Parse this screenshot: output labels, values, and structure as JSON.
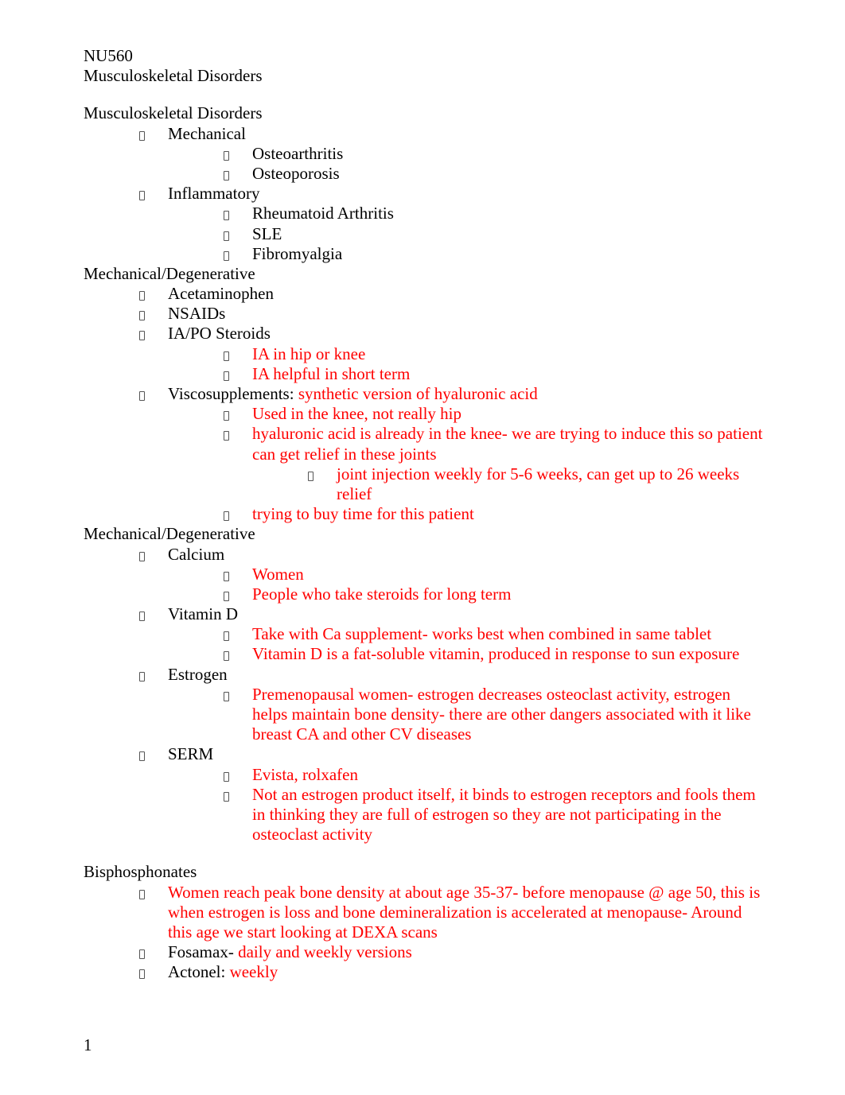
{
  "header": {
    "line1": "NU560",
    "line2": "Musculoskeletal Disorders"
  },
  "section1": {
    "title": "Musculoskeletal Disorders",
    "items": [
      {
        "label": "Mechanical",
        "children": [
          "Osteoarthritis",
          "Osteoporosis"
        ]
      },
      {
        "label": "Inflammatory",
        "children": [
          "Rheumatoid Arthritis",
          "SLE",
          "Fibromyalgia"
        ]
      }
    ]
  },
  "section2": {
    "title": "Mechanical/Degenerative",
    "i0": "Acetaminophen",
    "i1": "NSAIDs",
    "i2": "IA/PO Steroids",
    "i2c0": "IA in hip or knee",
    "i2c1": "IA helpful in short term",
    "i3a": "Viscosupplements: ",
    "i3b": "synthetic version of hyaluronic acid",
    "i3c0": "Used in the knee, not really hip",
    "i3c1": "hyaluronic acid is already in the knee- we are trying to induce this so patient can get relief in these joints",
    "i3c1c0": "joint injection weekly for 5-6 weeks, can get up to 26 weeks relief",
    "i3c2": "trying to buy time for this patient"
  },
  "section3": {
    "title": "Mechanical/Degenerative",
    "i0": "Calcium",
    "i0c0": "Women",
    "i0c1": "People who take steroids for long term",
    "i1": "Vitamin D",
    "i1c0": "Take with Ca supplement- works best when combined in same tablet",
    "i1c1": "Vitamin D is a fat-soluble vitamin, produced in response to sun exposure",
    "i2": "Estrogen",
    "i2c0a": "Premenopausal women- estrogen decreases osteoclast activity, ",
    "i2c0b": "   estrogen helps maintain bone density- there are other dangers associated with it like breast CA and other CV diseases",
    "i3": "SERM",
    "i3c0": "Evista, rolxafen",
    "i3c1": "Not an estrogen product itself, it binds to estrogen receptors and fools them in thinking they are full of estrogen so they are not participating in the osteoclast activity"
  },
  "section4": {
    "title": "Bisphosphonates",
    "i0": "Women reach peak bone density at about age 35-37- before menopause @ age 50, this is when estrogen is loss and bone demineralization is accelerated at menopause- Around this age we start looking at DEXA scans",
    "i1a": "Fosamax- ",
    "i1b": "daily and weekly versions",
    "i2a": "Actonel: ",
    "i2b": "weekly"
  },
  "pageNumber": "1"
}
